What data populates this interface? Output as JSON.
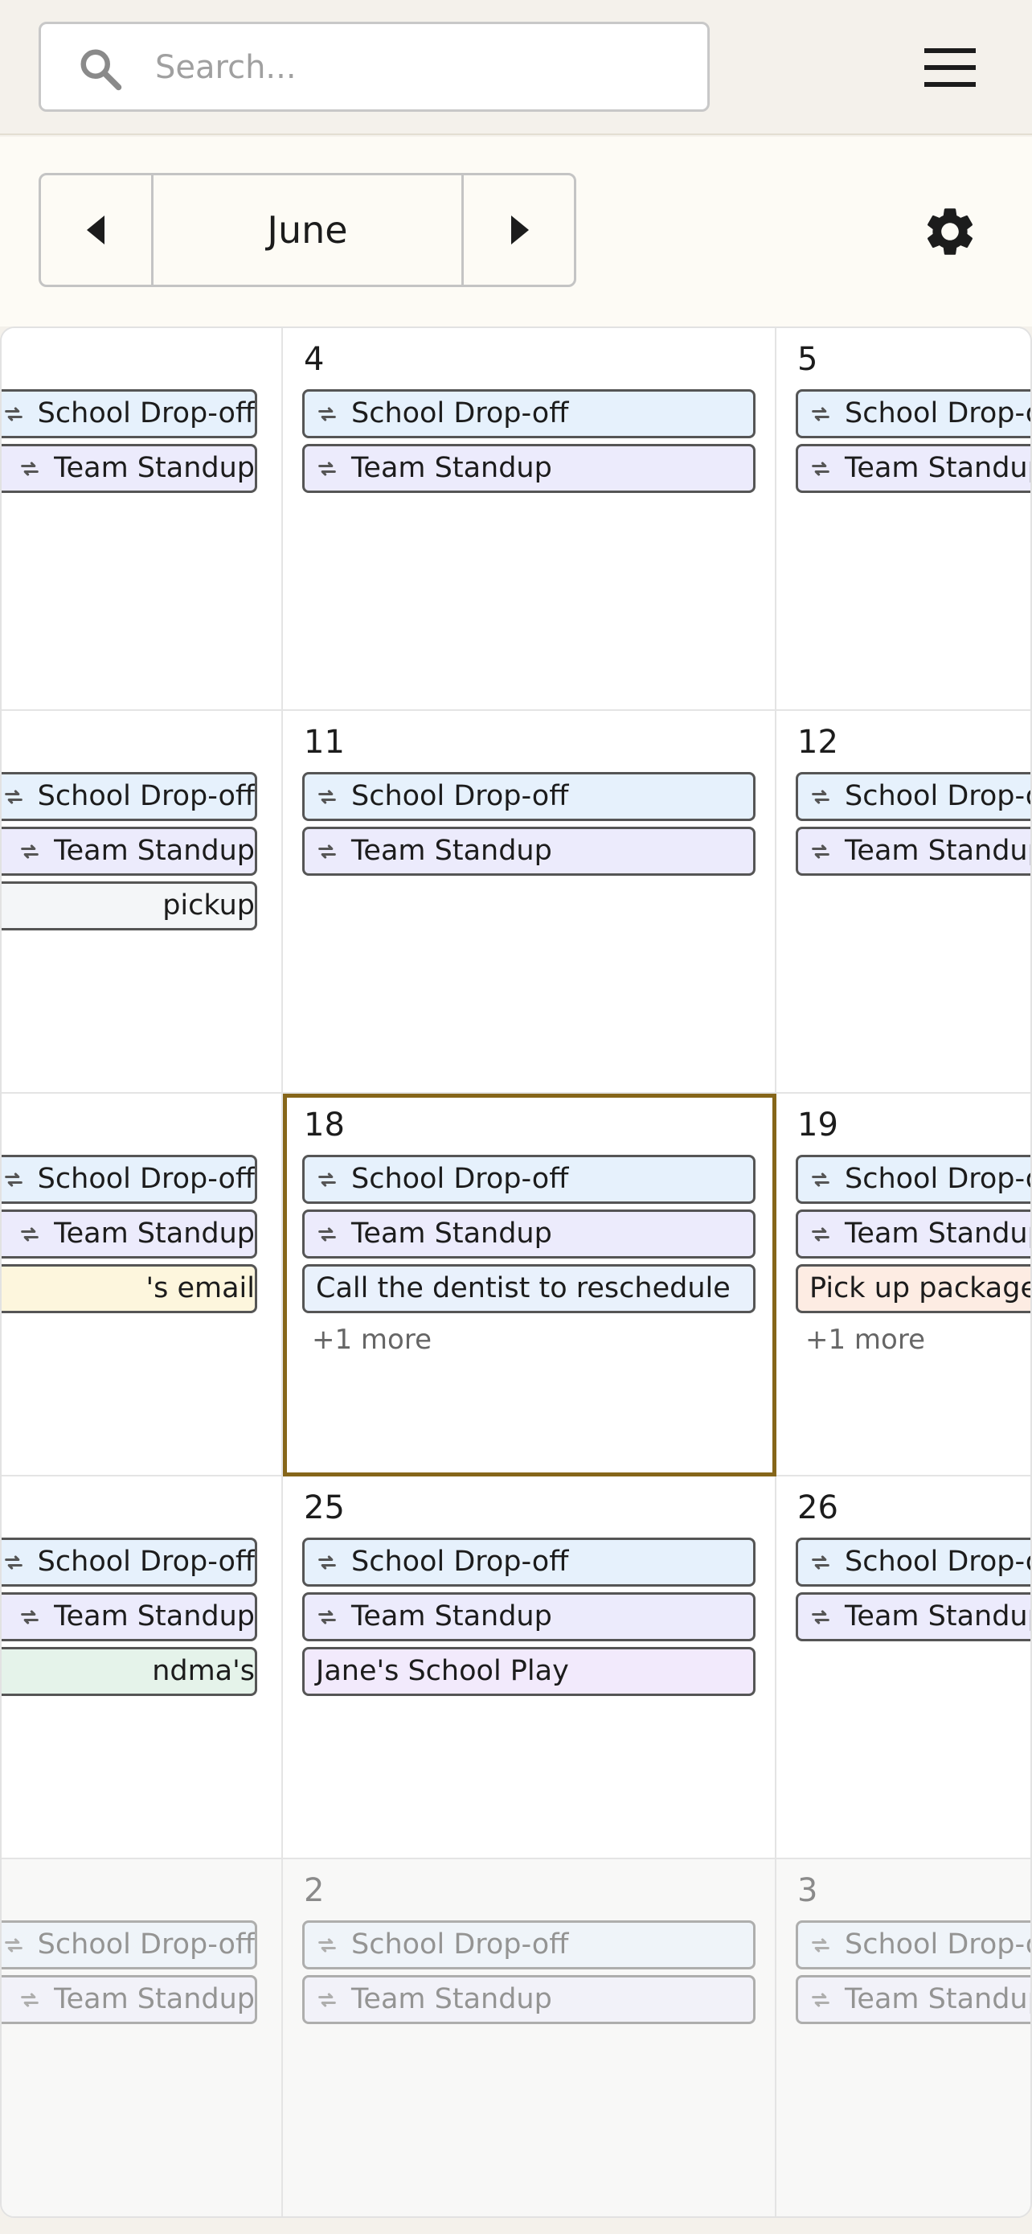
{
  "search": {
    "placeholder": "Search..."
  },
  "icons": {
    "search": "search-icon",
    "menu": "hamburger-menu-icon",
    "prev": "caret-left-icon",
    "next": "caret-right-icon",
    "settings": "gear-icon",
    "repeat": "repeat-icon"
  },
  "colors": {
    "accent_today": "#86661a",
    "event_blue": "#e6f1fc",
    "event_purple": "#ecebfc",
    "event_gray": "#f4f6f8",
    "event_yellow": "#fdf6dd",
    "event_green": "#e5f3ea",
    "event_lavender": "#f2eafc",
    "event_peach": "#fdece3"
  },
  "month_nav": {
    "label": "June"
  },
  "calendar": {
    "rows": [
      {
        "cells": [
          {
            "day": "",
            "events": [
              {
                "text": "School Drop-off",
                "color": "blue",
                "repeat": true
              },
              {
                "text": "Team Standup",
                "color": "purple",
                "repeat": true
              }
            ]
          },
          {
            "day": "4",
            "events": [
              {
                "text": "School Drop-off",
                "color": "blue",
                "repeat": true
              },
              {
                "text": "Team Standup",
                "color": "purple",
                "repeat": true
              }
            ]
          },
          {
            "day": "5",
            "events": [
              {
                "text": "School Drop-off",
                "color": "blue",
                "repeat": true
              },
              {
                "text": "Team Standup",
                "color": "purple",
                "repeat": true
              }
            ]
          }
        ]
      },
      {
        "cells": [
          {
            "day": "",
            "events": [
              {
                "text": "School Drop-off",
                "color": "blue",
                "repeat": true
              },
              {
                "text": "Team Standup",
                "color": "purple",
                "repeat": true
              },
              {
                "text": "pickup",
                "color": "gray",
                "repeat": false
              }
            ]
          },
          {
            "day": "11",
            "events": [
              {
                "text": "School Drop-off",
                "color": "blue",
                "repeat": true
              },
              {
                "text": "Team Standup",
                "color": "purple",
                "repeat": true
              }
            ]
          },
          {
            "day": "12",
            "events": [
              {
                "text": "School Drop-off",
                "color": "blue",
                "repeat": true
              },
              {
                "text": "Team Standup",
                "color": "purple",
                "repeat": true
              }
            ]
          }
        ]
      },
      {
        "cells": [
          {
            "day": "",
            "events": [
              {
                "text": "School Drop-off",
                "color": "blue",
                "repeat": true
              },
              {
                "text": "Team Standup",
                "color": "purple",
                "repeat": true
              },
              {
                "text": "'s email",
                "color": "yellow",
                "repeat": false
              }
            ]
          },
          {
            "day": "18",
            "today": true,
            "more": "+1 more",
            "events": [
              {
                "text": "School Drop-off",
                "color": "blue",
                "repeat": true
              },
              {
                "text": "Team Standup",
                "color": "purple",
                "repeat": true
              },
              {
                "text": "Call the dentist to reschedule",
                "color": "dentist",
                "repeat": false
              }
            ]
          },
          {
            "day": "19",
            "more": "+1 more",
            "events": [
              {
                "text": "School Drop-off",
                "color": "blue",
                "repeat": true
              },
              {
                "text": "Team Standup",
                "color": "purple",
                "repeat": true
              },
              {
                "text": "Pick up package",
                "color": "peach",
                "repeat": false
              }
            ]
          }
        ]
      },
      {
        "cells": [
          {
            "day": "",
            "events": [
              {
                "text": "School Drop-off",
                "color": "blue",
                "repeat": true
              },
              {
                "text": "Team Standup",
                "color": "purple",
                "repeat": true
              },
              {
                "text": "ndma's",
                "color": "green",
                "repeat": false
              }
            ]
          },
          {
            "day": "25",
            "events": [
              {
                "text": "School Drop-off",
                "color": "blue",
                "repeat": true
              },
              {
                "text": "Team Standup",
                "color": "purple",
                "repeat": true
              },
              {
                "text": "Jane's School Play",
                "color": "lavender",
                "repeat": false
              }
            ]
          },
          {
            "day": "26",
            "events": [
              {
                "text": "School Drop-off",
                "color": "blue",
                "repeat": true
              },
              {
                "text": "Team Standup",
                "color": "purple",
                "repeat": true
              }
            ]
          }
        ]
      },
      {
        "faded": true,
        "cells": [
          {
            "day": "",
            "events": [
              {
                "text": "School Drop-off",
                "color": "blue",
                "repeat": true
              },
              {
                "text": "Team Standup",
                "color": "purple",
                "repeat": true
              }
            ]
          },
          {
            "day": "2",
            "events": [
              {
                "text": "School Drop-off",
                "color": "blue",
                "repeat": true
              },
              {
                "text": "Team Standup",
                "color": "purple",
                "repeat": true
              }
            ]
          },
          {
            "day": "3",
            "events": [
              {
                "text": "School Drop-off",
                "color": "blue",
                "repeat": true
              },
              {
                "text": "Team Standup",
                "color": "purple",
                "repeat": true
              }
            ]
          }
        ]
      }
    ]
  }
}
